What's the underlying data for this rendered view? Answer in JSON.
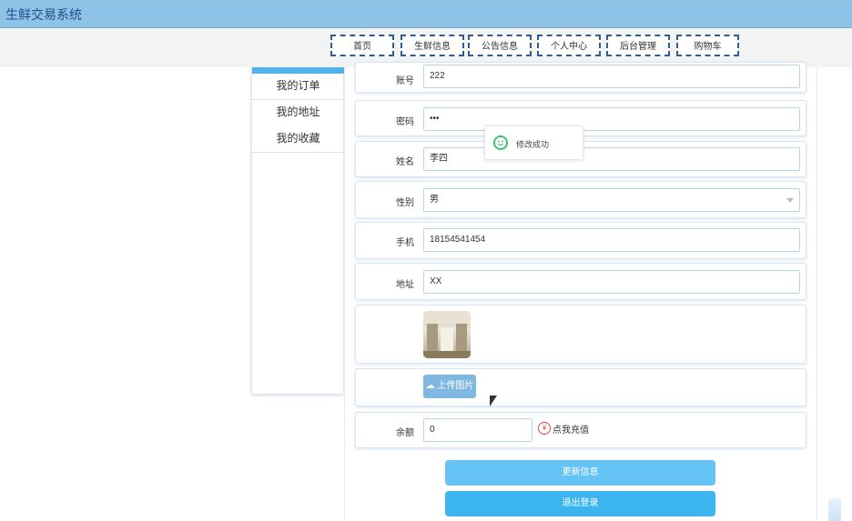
{
  "app": {
    "title": "生鲜交易系统"
  },
  "nav": [
    "首页",
    "生鲜信息",
    "公告信息",
    "个人中心",
    "后台管理",
    "购物车"
  ],
  "sidebar": {
    "items": [
      "我的订单",
      "我的地址",
      "我的收藏"
    ]
  },
  "form": {
    "account_label": "账号",
    "account_value": "222",
    "password_label": "密码",
    "password_value": "•••",
    "name_label": "姓名",
    "name_value": "李四",
    "gender_label": "性别",
    "gender_value": "男",
    "phone_label": "手机",
    "phone_value": "18154541454",
    "address_label": "地址",
    "address_value": "XX",
    "upload_label": "上传图片",
    "balance_label": "余额",
    "balance_value": "0",
    "recharge_label": "点我充值"
  },
  "buttons": {
    "update": "更新信息",
    "logout": "退出登录"
  },
  "toast": {
    "message": "修改成功"
  }
}
